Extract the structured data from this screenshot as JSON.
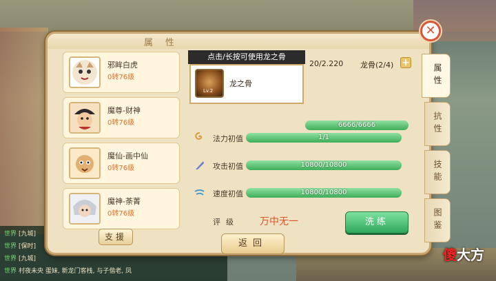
{
  "panel": {
    "title": "属性",
    "support_label": "支援"
  },
  "pets": [
    {
      "name": "邪眸白虎",
      "level": "0转76级",
      "avatar": "tiger-avatar-icon"
    },
    {
      "name": "魔尊-财神",
      "level": "0转76级",
      "avatar": "fortune-god-avatar-icon"
    },
    {
      "name": "魔仙-画中仙",
      "level": "0转76级",
      "avatar": "painting-immortal-avatar-icon"
    },
    {
      "name": "魔神-荼菁",
      "level": "0转76级",
      "avatar": "tujing-avatar-icon"
    }
  ],
  "bone": {
    "hint": "点击/长按可使用龙之骨",
    "name": "龙之骨",
    "icon_level": "Lv.2",
    "top_value": "20/2.220",
    "dragonbone_label": "龙骨(2/4)",
    "hp_bar": "6666/6666"
  },
  "stats": [
    {
      "label": "法力初值",
      "value": "1/1",
      "progress": 1.0,
      "icon": "mana-swirl-icon"
    },
    {
      "label": "攻击初值",
      "value": "10800/10800",
      "progress": 1.0,
      "icon": "attack-feather-icon"
    },
    {
      "label": "速度初值",
      "value": "10800/10800",
      "progress": 1.0,
      "icon": "speed-wind-icon"
    }
  ],
  "grade": {
    "label": "评级",
    "value": "万中无一"
  },
  "buttons": {
    "wash": "洗练",
    "back": "返回",
    "close": "✕"
  },
  "side_tabs": [
    "属性",
    "抗性",
    "技能",
    "图鉴"
  ],
  "chat": [
    {
      "tag": "世界",
      "text": "[九城]"
    },
    {
      "tag": "世界",
      "text": "[保时]"
    },
    {
      "tag": "世界",
      "text": "[九城]"
    },
    {
      "tag": "世界",
      "text": "村夜未央 蛋妹, 新龙门客栈, 与子偕老, 凤"
    }
  ],
  "watermark": {
    "first": "傻",
    "rest": "大方"
  },
  "colors": {
    "accent_green": "#3fae5a",
    "level_orange": "#e0702a",
    "grade_red": "#d8552a",
    "close_red": "#d8553a"
  }
}
